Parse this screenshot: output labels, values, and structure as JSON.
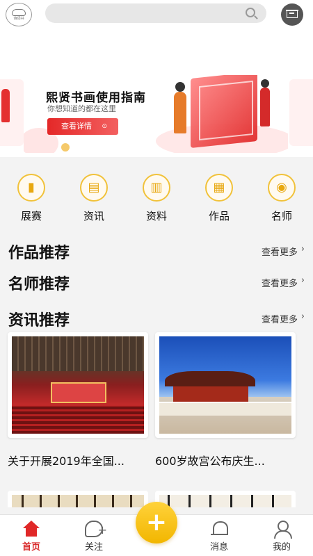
{
  "header": {
    "logo_text": "诗词书"
  },
  "banner": {
    "title": "熙贤书画使用指南",
    "subtitle": "你想知道的都在这里",
    "cta_label": "查看详情"
  },
  "categories": [
    {
      "label": "展赛",
      "icon": "trophy-icon"
    },
    {
      "label": "资讯",
      "icon": "news-icon"
    },
    {
      "label": "资料",
      "icon": "books-icon"
    },
    {
      "label": "作品",
      "icon": "artwork-icon"
    },
    {
      "label": "名师",
      "icon": "teacher-icon"
    }
  ],
  "sections": {
    "works": {
      "title": "作品推荐",
      "more": "查看更多"
    },
    "masters": {
      "title": "名师推荐",
      "more": "查看更多"
    },
    "news": {
      "title": "资讯推荐",
      "more": "查看更多",
      "items": [
        {
          "caption": "关于开展2019年全国..."
        },
        {
          "caption": "600岁故宫公布庆生..."
        }
      ]
    }
  },
  "nav": {
    "items": [
      {
        "label": "首页",
        "icon": "home-icon",
        "active": true
      },
      {
        "label": "关注",
        "icon": "follow-icon"
      },
      {
        "label": "消息",
        "icon": "bell-icon"
      },
      {
        "label": "我的",
        "icon": "user-icon"
      }
    ],
    "fab_icon": "plus-icon",
    "fab_glyph": "+"
  },
  "colors": {
    "accent_red": "#e02828",
    "accent_yellow": "#f2b600"
  }
}
